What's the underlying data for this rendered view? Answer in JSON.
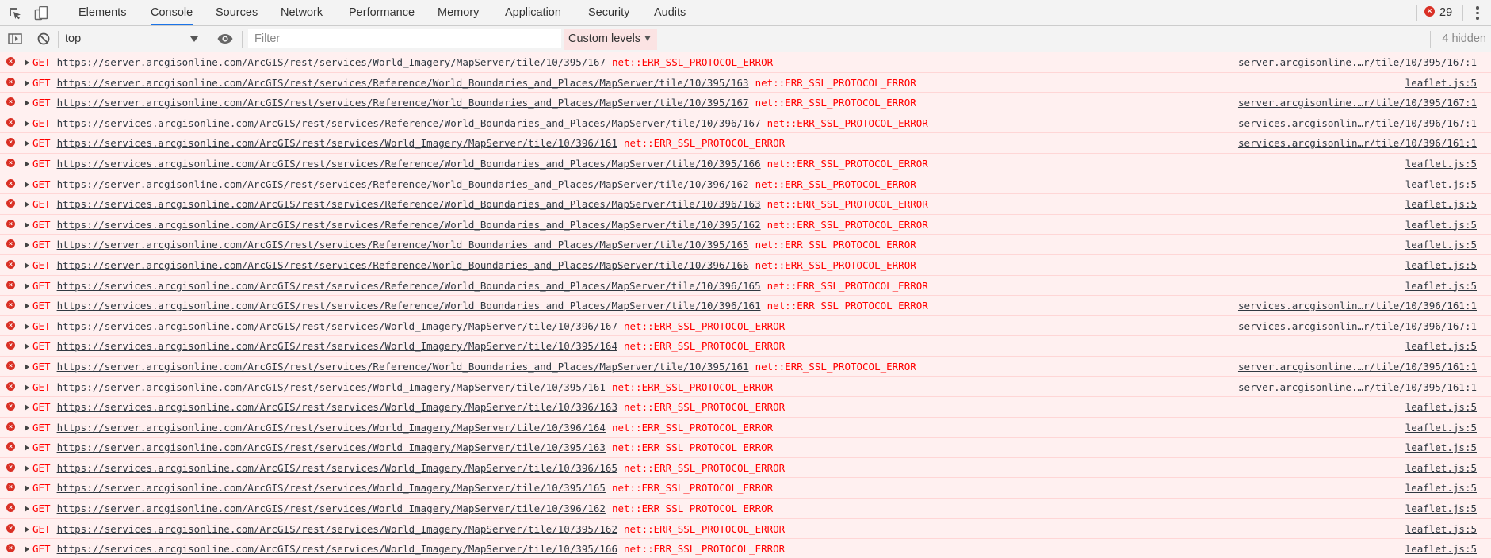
{
  "tabs": [
    {
      "label": "Elements",
      "active": false
    },
    {
      "label": "Console",
      "active": true
    },
    {
      "label": "Sources",
      "active": false
    },
    {
      "label": "Network",
      "active": false
    },
    {
      "label": "Performance",
      "active": false
    },
    {
      "label": "Memory",
      "active": false
    },
    {
      "label": "Application",
      "active": false
    },
    {
      "label": "Security",
      "active": false
    },
    {
      "label": "Audits",
      "active": false
    }
  ],
  "error_count": "29",
  "toolbar": {
    "context": "top",
    "filter_placeholder": "Filter",
    "levels_label": "Custom levels",
    "hidden_count": "4 hidden"
  },
  "colors": {
    "error_text": "#ff0000",
    "row_background": "#fff0f0",
    "active_tab_underline": "#1a73e8",
    "error_icon": "#d93025"
  },
  "icons": [
    "inspect-element-icon",
    "device-toolbar-icon",
    "show-sidebar-icon",
    "clear-console-icon",
    "eye-icon",
    "error-icon",
    "more-options-icon",
    "expand-triangle-icon"
  ],
  "logs": [
    {
      "method": "GET",
      "url": "https://server.arcgisonline.com/ArcGIS/rest/services/World_Imagery/MapServer/tile/10/395/167",
      "error": "net::ERR_SSL_PROTOCOL_ERROR",
      "source": "server.arcgisonline.…r/tile/10/395/167:1"
    },
    {
      "method": "GET",
      "url": "https://server.arcgisonline.com/ArcGIS/rest/services/Reference/World_Boundaries_and_Places/MapServer/tile/10/395/163",
      "error": "net::ERR_SSL_PROTOCOL_ERROR",
      "source": "leaflet.js:5"
    },
    {
      "method": "GET",
      "url": "https://server.arcgisonline.com/ArcGIS/rest/services/Reference/World_Boundaries_and_Places/MapServer/tile/10/395/167",
      "error": "net::ERR_SSL_PROTOCOL_ERROR",
      "source": "server.arcgisonline.…r/tile/10/395/167:1"
    },
    {
      "method": "GET",
      "url": "https://services.arcgisonline.com/ArcGIS/rest/services/Reference/World_Boundaries_and_Places/MapServer/tile/10/396/167",
      "error": "net::ERR_SSL_PROTOCOL_ERROR",
      "source": "services.arcgisonlin…r/tile/10/396/167:1"
    },
    {
      "method": "GET",
      "url": "https://services.arcgisonline.com/ArcGIS/rest/services/World_Imagery/MapServer/tile/10/396/161",
      "error": "net::ERR_SSL_PROTOCOL_ERROR",
      "source": "services.arcgisonlin…r/tile/10/396/161:1"
    },
    {
      "method": "GET",
      "url": "https://services.arcgisonline.com/ArcGIS/rest/services/Reference/World_Boundaries_and_Places/MapServer/tile/10/395/166",
      "error": "net::ERR_SSL_PROTOCOL_ERROR",
      "source": "leaflet.js:5"
    },
    {
      "method": "GET",
      "url": "https://server.arcgisonline.com/ArcGIS/rest/services/Reference/World_Boundaries_and_Places/MapServer/tile/10/396/162",
      "error": "net::ERR_SSL_PROTOCOL_ERROR",
      "source": "leaflet.js:5"
    },
    {
      "method": "GET",
      "url": "https://services.arcgisonline.com/ArcGIS/rest/services/Reference/World_Boundaries_and_Places/MapServer/tile/10/396/163",
      "error": "net::ERR_SSL_PROTOCOL_ERROR",
      "source": "leaflet.js:5"
    },
    {
      "method": "GET",
      "url": "https://services.arcgisonline.com/ArcGIS/rest/services/Reference/World_Boundaries_and_Places/MapServer/tile/10/395/162",
      "error": "net::ERR_SSL_PROTOCOL_ERROR",
      "source": "leaflet.js:5"
    },
    {
      "method": "GET",
      "url": "https://server.arcgisonline.com/ArcGIS/rest/services/Reference/World_Boundaries_and_Places/MapServer/tile/10/395/165",
      "error": "net::ERR_SSL_PROTOCOL_ERROR",
      "source": "leaflet.js:5"
    },
    {
      "method": "GET",
      "url": "https://server.arcgisonline.com/ArcGIS/rest/services/Reference/World_Boundaries_and_Places/MapServer/tile/10/396/166",
      "error": "net::ERR_SSL_PROTOCOL_ERROR",
      "source": "leaflet.js:5"
    },
    {
      "method": "GET",
      "url": "https://services.arcgisonline.com/ArcGIS/rest/services/Reference/World_Boundaries_and_Places/MapServer/tile/10/396/165",
      "error": "net::ERR_SSL_PROTOCOL_ERROR",
      "source": "leaflet.js:5"
    },
    {
      "method": "GET",
      "url": "https://services.arcgisonline.com/ArcGIS/rest/services/Reference/World_Boundaries_and_Places/MapServer/tile/10/396/161",
      "error": "net::ERR_SSL_PROTOCOL_ERROR",
      "source": "services.arcgisonlin…r/tile/10/396/161:1"
    },
    {
      "method": "GET",
      "url": "https://services.arcgisonline.com/ArcGIS/rest/services/World_Imagery/MapServer/tile/10/396/167",
      "error": "net::ERR_SSL_PROTOCOL_ERROR",
      "source": "services.arcgisonlin…r/tile/10/396/167:1"
    },
    {
      "method": "GET",
      "url": "https://services.arcgisonline.com/ArcGIS/rest/services/World_Imagery/MapServer/tile/10/395/164",
      "error": "net::ERR_SSL_PROTOCOL_ERROR",
      "source": "leaflet.js:5"
    },
    {
      "method": "GET",
      "url": "https://server.arcgisonline.com/ArcGIS/rest/services/Reference/World_Boundaries_and_Places/MapServer/tile/10/395/161",
      "error": "net::ERR_SSL_PROTOCOL_ERROR",
      "source": "server.arcgisonline.…r/tile/10/395/161:1"
    },
    {
      "method": "GET",
      "url": "https://server.arcgisonline.com/ArcGIS/rest/services/World_Imagery/MapServer/tile/10/395/161",
      "error": "net::ERR_SSL_PROTOCOL_ERROR",
      "source": "server.arcgisonline.…r/tile/10/395/161:1"
    },
    {
      "method": "GET",
      "url": "https://services.arcgisonline.com/ArcGIS/rest/services/World_Imagery/MapServer/tile/10/396/163",
      "error": "net::ERR_SSL_PROTOCOL_ERROR",
      "source": "leaflet.js:5"
    },
    {
      "method": "GET",
      "url": "https://server.arcgisonline.com/ArcGIS/rest/services/World_Imagery/MapServer/tile/10/396/164",
      "error": "net::ERR_SSL_PROTOCOL_ERROR",
      "source": "leaflet.js:5"
    },
    {
      "method": "GET",
      "url": "https://server.arcgisonline.com/ArcGIS/rest/services/World_Imagery/MapServer/tile/10/395/163",
      "error": "net::ERR_SSL_PROTOCOL_ERROR",
      "source": "leaflet.js:5"
    },
    {
      "method": "GET",
      "url": "https://services.arcgisonline.com/ArcGIS/rest/services/World_Imagery/MapServer/tile/10/396/165",
      "error": "net::ERR_SSL_PROTOCOL_ERROR",
      "source": "leaflet.js:5"
    },
    {
      "method": "GET",
      "url": "https://server.arcgisonline.com/ArcGIS/rest/services/World_Imagery/MapServer/tile/10/395/165",
      "error": "net::ERR_SSL_PROTOCOL_ERROR",
      "source": "leaflet.js:5"
    },
    {
      "method": "GET",
      "url": "https://server.arcgisonline.com/ArcGIS/rest/services/World_Imagery/MapServer/tile/10/396/162",
      "error": "net::ERR_SSL_PROTOCOL_ERROR",
      "source": "leaflet.js:5"
    },
    {
      "method": "GET",
      "url": "https://services.arcgisonline.com/ArcGIS/rest/services/World_Imagery/MapServer/tile/10/395/162",
      "error": "net::ERR_SSL_PROTOCOL_ERROR",
      "source": "leaflet.js:5"
    },
    {
      "method": "GET",
      "url": "https://services.arcgisonline.com/ArcGIS/rest/services/World_Imagery/MapServer/tile/10/395/166",
      "error": "net::ERR_SSL_PROTOCOL_ERROR",
      "source": "leaflet.js:5"
    }
  ]
}
